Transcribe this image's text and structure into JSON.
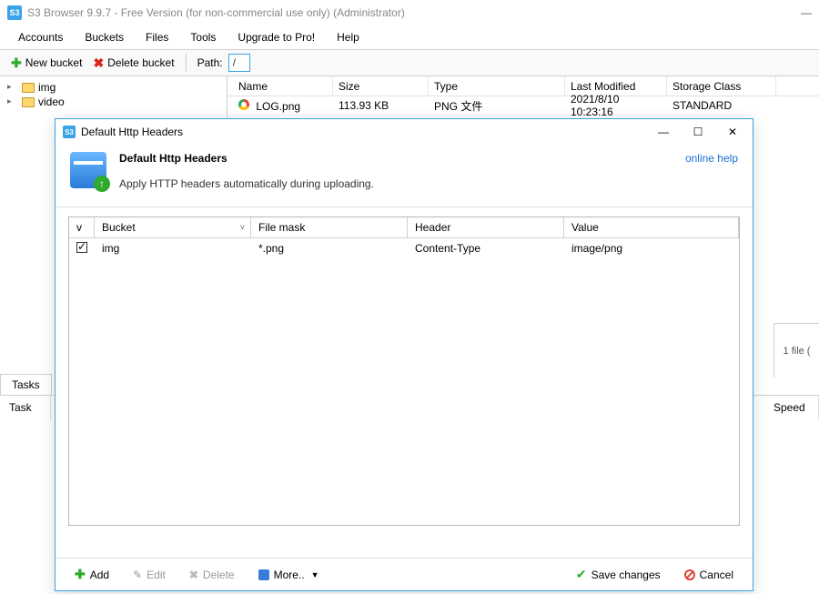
{
  "window": {
    "title": "S3 Browser 9.9.7 - Free Version (for non-commercial use only) (Administrator)"
  },
  "menu": {
    "accounts": "Accounts",
    "buckets": "Buckets",
    "files": "Files",
    "tools": "Tools",
    "upgrade": "Upgrade to Pro!",
    "help": "Help"
  },
  "toolbar": {
    "new_bucket": "New bucket",
    "delete_bucket": "Delete bucket",
    "path_label": "Path:",
    "path_value": "/"
  },
  "tree": {
    "items": [
      {
        "label": "img"
      },
      {
        "label": "video"
      }
    ]
  },
  "files": {
    "columns": {
      "name": "Name",
      "size": "Size",
      "type": "Type",
      "modified": "Last Modified",
      "storage": "Storage Class"
    },
    "rows": [
      {
        "name": "LOG.png",
        "size": "113.93 KB",
        "type": "PNG 文件",
        "modified": "2021/8/10 10:23:16",
        "storage": "STANDARD"
      }
    ],
    "status_right": "1 file ("
  },
  "tasks": {
    "tab": "Tasks",
    "col_task": "Task",
    "col_speed": "Speed"
  },
  "dialog": {
    "title": "Default Http Headers",
    "heading": "Default Http Headers",
    "subheading": "Apply HTTP headers automatically during uploading.",
    "online_help": "online help",
    "columns": {
      "v": "v",
      "bucket": "Bucket",
      "mask": "File mask",
      "header": "Header",
      "value": "Value"
    },
    "rows": [
      {
        "checked": true,
        "bucket": "img",
        "mask": "*.png",
        "header": "Content-Type",
        "value": "image/png"
      }
    ],
    "footer": {
      "add": "Add",
      "edit": "Edit",
      "delete": "Delete",
      "more": "More..",
      "save": "Save changes",
      "cancel": "Cancel"
    }
  }
}
